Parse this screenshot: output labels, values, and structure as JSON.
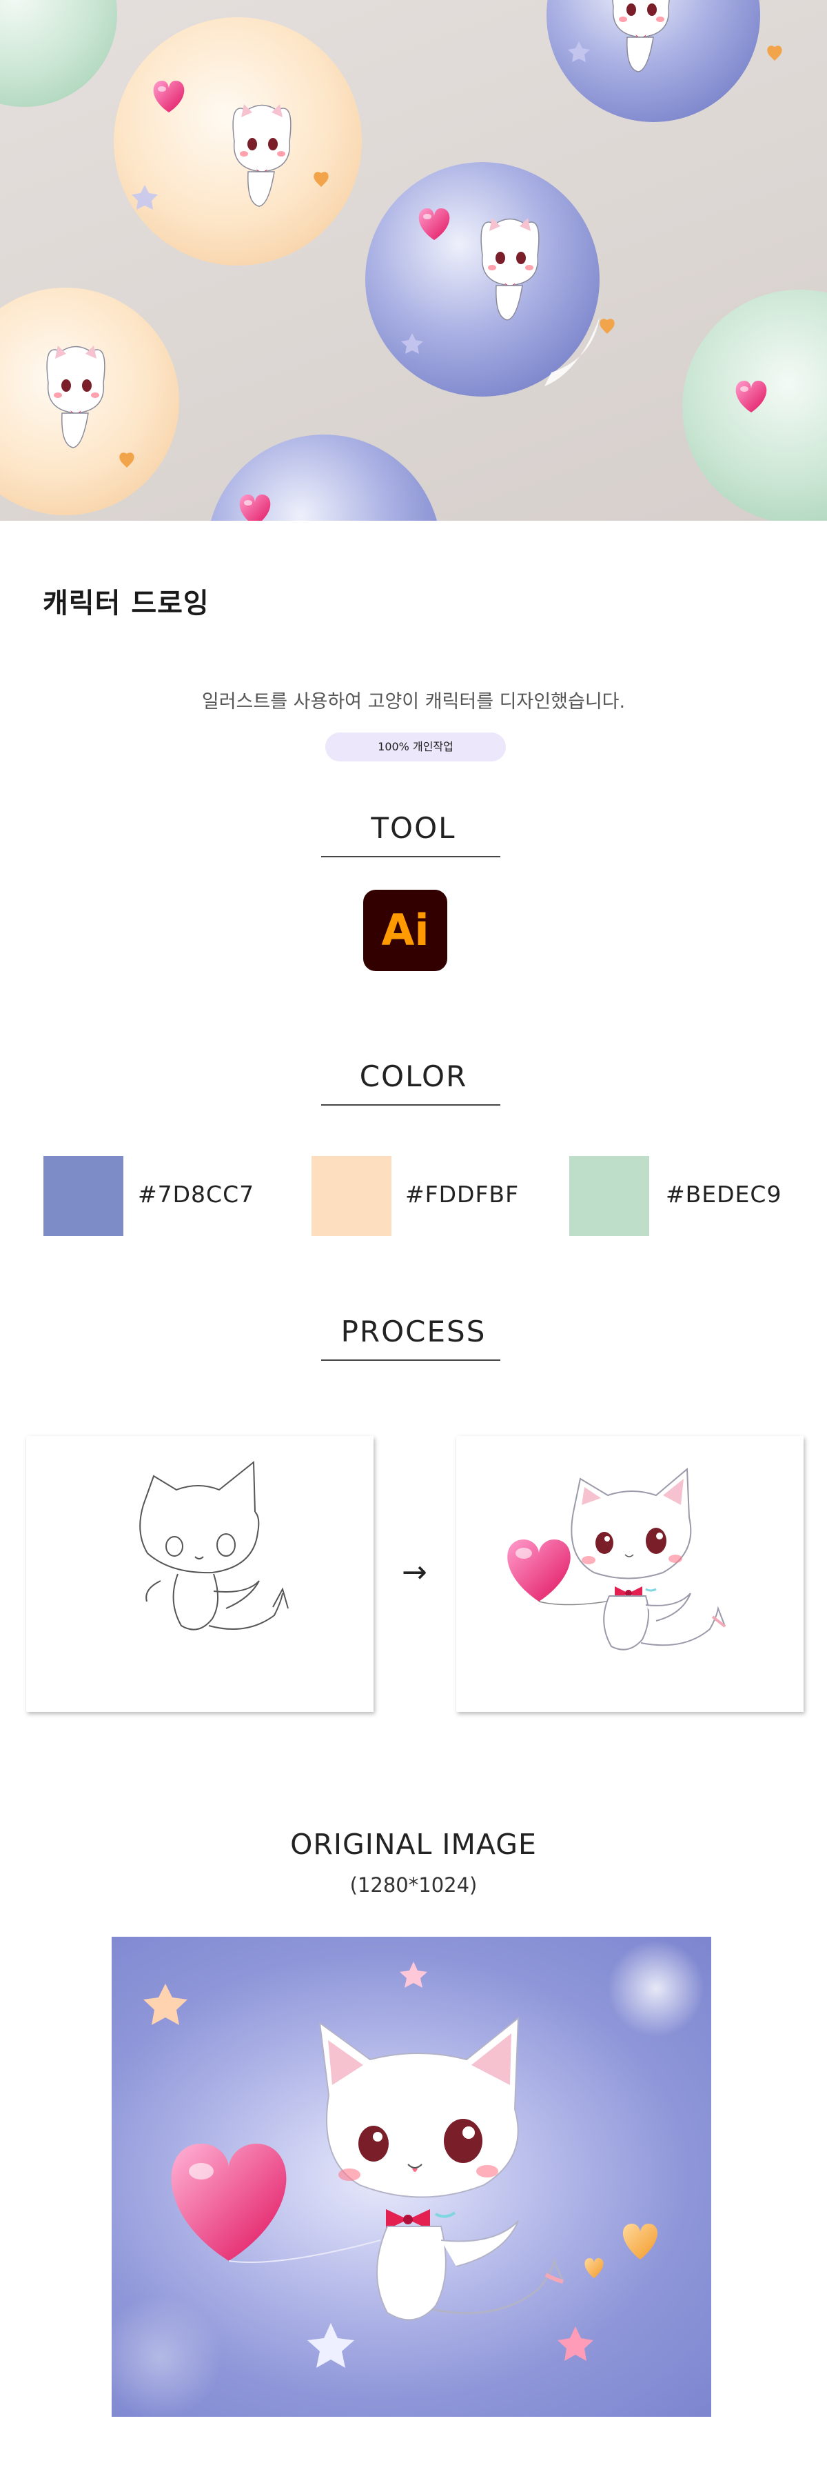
{
  "header": {
    "title": "캐릭터 드로잉",
    "description": "일러스트를 사용하여 고양이 캐릭터를 디자인했습니다.",
    "badge": "100% 개인작업"
  },
  "tool": {
    "heading": "TOOL",
    "icon_name": "adobe-illustrator-icon",
    "icon_text": "Ai"
  },
  "color": {
    "heading": "COLOR",
    "swatches": [
      {
        "hex": "#7D8CC7",
        "label": "#7D8CC7"
      },
      {
        "hex": "#FDDFBF",
        "label": "#FDDFBF"
      },
      {
        "hex": "#BEDEC9",
        "label": "#BEDEC9"
      }
    ]
  },
  "process": {
    "heading": "PROCESS",
    "arrow": "→"
  },
  "original": {
    "heading": "ORIGINAL IMAGE",
    "size": "(1280*1024)"
  }
}
